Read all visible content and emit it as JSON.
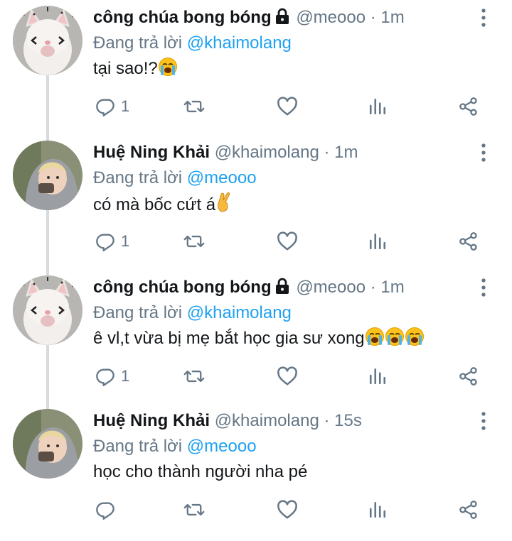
{
  "tweets": [
    {
      "display_name": "công chúa bong bóng",
      "protected": true,
      "handle_time": "@meooo · 1m",
      "reply_prefix": "Đang trả lời",
      "reply_to": "@khaimolang",
      "text": "tại sao!?",
      "emojis": [
        "loudly-crying-face"
      ],
      "reply_count": "1",
      "avatar": "cat"
    },
    {
      "display_name": "Huệ Ning Khải",
      "protected": false,
      "handle_time": "@khaimolang · 1m",
      "reply_prefix": "Đang trả lời",
      "reply_to": "@meooo",
      "text": "có mà bốc cứt á",
      "emojis": [
        "crossed-fingers"
      ],
      "reply_count": "1",
      "avatar": "person-hoodie"
    },
    {
      "display_name": "công chúa bong bóng",
      "protected": true,
      "handle_time": "@meooo · 1m",
      "reply_prefix": "Đang trả lời",
      "reply_to": "@khaimolang",
      "text": "ê vl,t vừa bị mẹ bắt học gia sư xong",
      "emojis": [
        "loudly-crying-face",
        "loudly-crying-face",
        "loudly-crying-face"
      ],
      "reply_count": "1",
      "avatar": "cat"
    },
    {
      "display_name": "Huệ Ning Khải",
      "protected": false,
      "handle_time": "@khaimolang · 15s",
      "reply_prefix": "Đang trả lời",
      "reply_to": "@meooo",
      "text": "học cho thành người nha pé",
      "emojis": [],
      "reply_count": "",
      "avatar": "person-hoodie"
    }
  ],
  "icons": {
    "reply": "speech-bubble-icon",
    "retweet": "retweet-icon",
    "like": "heart-icon",
    "analytics": "bar-chart-icon",
    "share": "share-icon",
    "more": "vertical-dots-icon",
    "lock": "lock-icon"
  },
  "colors": {
    "text": "#14171a",
    "secondary": "#657786",
    "mention": "#1da1f2",
    "thread_line": "#d6dbdf"
  }
}
